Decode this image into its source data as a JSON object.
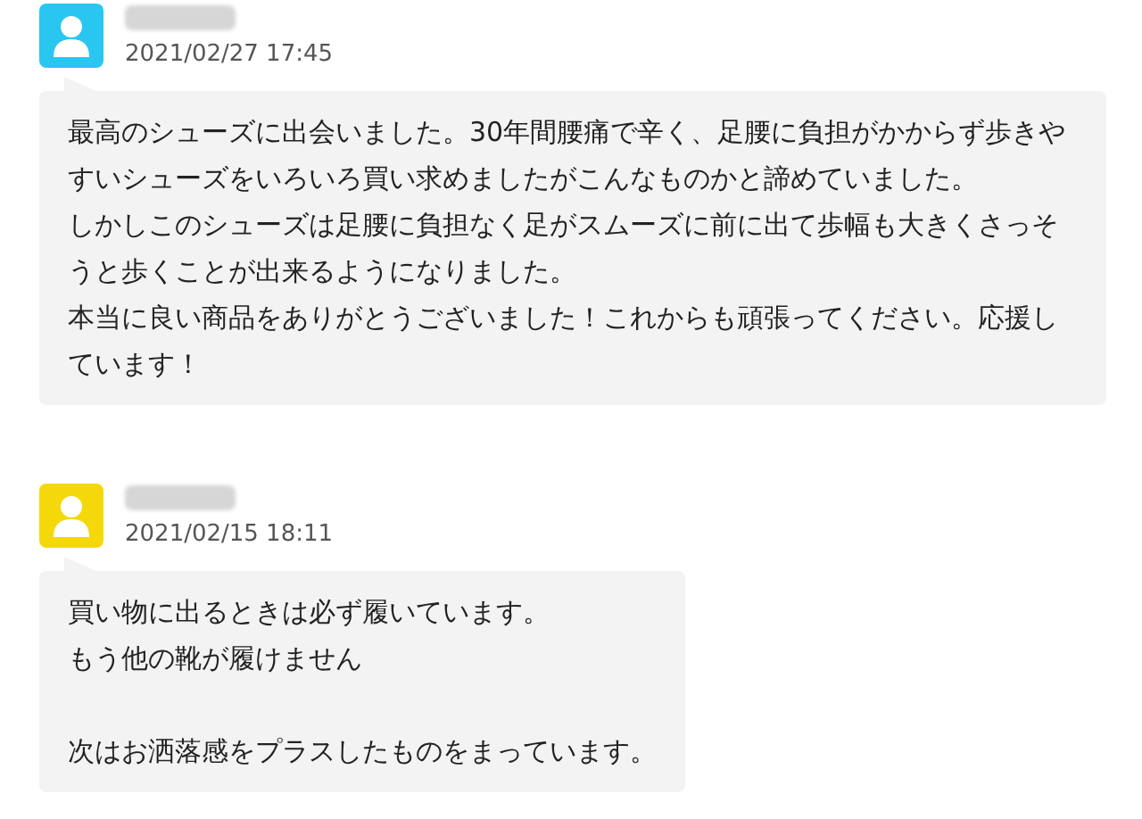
{
  "reviews": [
    {
      "color": "#29c6f0",
      "date": "2021/02/27 17:45",
      "blocks": [
        [
          "最高のシューズに出会いました。30年間腰痛で辛く、足腰に負担がかからず歩きやすいシューズをいろいろ買い求めましたがこんなものかと諦めていました。",
          "しかしこのシューズは足腰に負担なく足がスムーズに前に出て歩幅も大きくさっそうと歩くことが出来るようになりました。",
          "本当に良い商品をありがとうございました！これからも頑張ってください。応援しています！"
        ]
      ]
    },
    {
      "color": "#f5d80a",
      "date": "2021/02/15 18:11",
      "blocks": [
        [
          "買い物に出るときは必ず履いています。",
          "もう他の靴が履けません"
        ],
        [
          "次はお洒落感をプラスしたものをまっています。"
        ]
      ]
    }
  ]
}
